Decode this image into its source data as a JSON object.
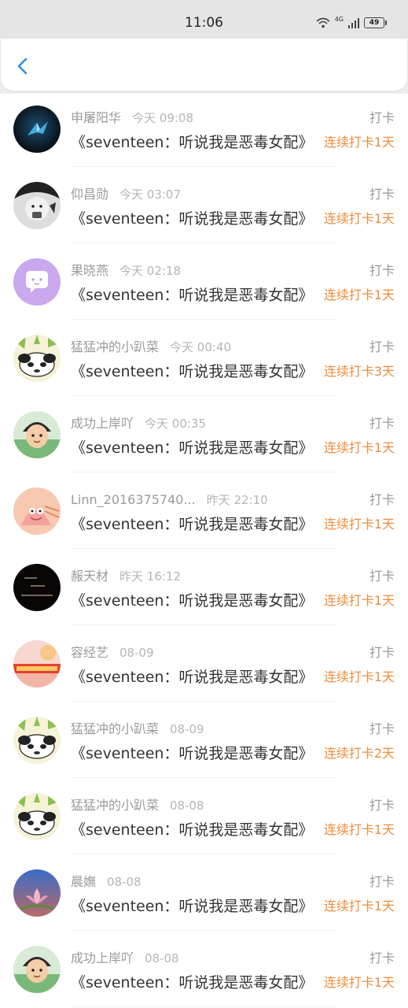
{
  "status_bar": {
    "time": "11:06",
    "network": "4G",
    "battery": "49"
  },
  "header": {
    "back_icon": "chevron-left-icon"
  },
  "rows": [
    {
      "name": "申屠阳华",
      "time": "今天 09:08",
      "title": "《seventeen：听说我是恶毒女配》",
      "action": "打卡",
      "streak": "连续打卡1天",
      "avatar": "crane"
    },
    {
      "name": "仰昌勋",
      "time": "今天 03:07",
      "title": "《seventeen：听说我是恶毒女配》",
      "action": "打卡",
      "streak": "连续打卡1天",
      "avatar": "girl-bw"
    },
    {
      "name": "果晓燕",
      "time": "今天 02:18",
      "title": "《seventeen：听说我是恶毒女配》",
      "action": "打卡",
      "streak": "连续打卡1天",
      "avatar": "purple-chat"
    },
    {
      "name": "猛猛冲的小趴菜",
      "time": "今天 00:40",
      "title": "《seventeen：听说我是恶毒女配》",
      "action": "打卡",
      "streak": "连续打卡3天",
      "avatar": "panda"
    },
    {
      "name": "成功上岸吖",
      "time": "今天 00:35",
      "title": "《seventeen：听说我是恶毒女配》",
      "action": "打卡",
      "streak": "连续打卡1天",
      "avatar": "child"
    },
    {
      "name": "Linn_2016375740...",
      "time": "昨天 22:10",
      "title": "《seventeen：听说我是恶毒女配》",
      "action": "打卡",
      "streak": "连续打卡1天",
      "avatar": "patrick"
    },
    {
      "name": "赧天材",
      "time": "昨天 16:12",
      "title": "《seventeen：听说我是恶毒女配》",
      "action": "打卡",
      "streak": "连续打卡1天",
      "avatar": "dark-text"
    },
    {
      "name": "容经艺",
      "time": "08-09",
      "title": "《seventeen：听说我是恶毒女配》",
      "action": "打卡",
      "streak": "连续打卡1天",
      "avatar": "red-banner"
    },
    {
      "name": "猛猛冲的小趴菜",
      "time": "08-09",
      "title": "《seventeen：听说我是恶毒女配》",
      "action": "打卡",
      "streak": "连续打卡2天",
      "avatar": "panda"
    },
    {
      "name": "猛猛冲的小趴菜",
      "time": "08-08",
      "title": "《seventeen：听说我是恶毒女配》",
      "action": "打卡",
      "streak": "连续打卡1天",
      "avatar": "panda"
    },
    {
      "name": "晨嫵",
      "time": "08-08",
      "title": "《seventeen：听说我是恶毒女配》",
      "action": "打卡",
      "streak": "连续打卡1天",
      "avatar": "lotus"
    },
    {
      "name": "成功上岸吖",
      "time": "08-08",
      "title": "《seventeen：听说我是恶毒女配》",
      "action": "打卡",
      "streak": "连续打卡1天",
      "avatar": "child"
    }
  ],
  "colors": {
    "accent": "#ef8c3c",
    "back_icon": "#2f8fe6",
    "status_bar": "#e5e5e5"
  }
}
